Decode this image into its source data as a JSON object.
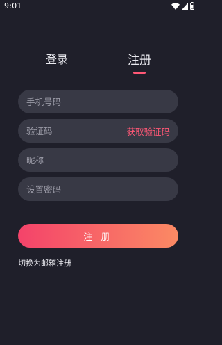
{
  "status_bar": {
    "time": "9:01",
    "icons": [
      "wifi-icon",
      "signal-icon",
      "battery-icon"
    ]
  },
  "tabs": [
    {
      "label": "登录",
      "active": false
    },
    {
      "label": "注册",
      "active": true
    }
  ],
  "form": {
    "phone_placeholder": "手机号码",
    "code_placeholder": "验证码",
    "get_code_label": "获取验证码",
    "nickname_placeholder": "昵称",
    "password_placeholder": "设置密码"
  },
  "submit_label": "注 册",
  "switch_link": "切换为邮箱注册",
  "colors": {
    "background": "#1f1f2a",
    "field_bg": "#383945",
    "accent": "#ff5876",
    "button_gradient_start": "#f4436a",
    "button_gradient_end": "#fb8a64"
  }
}
